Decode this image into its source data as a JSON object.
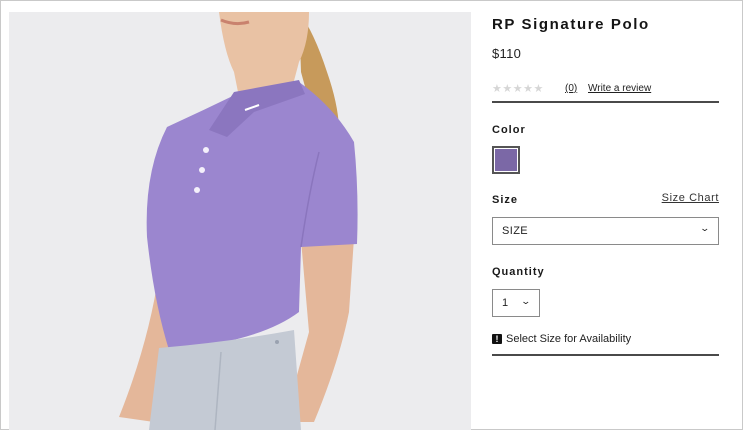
{
  "product": {
    "title": "RP Signature Polo",
    "price": "$110",
    "rating": {
      "stars": "★★★★★",
      "review_count": "(0)",
      "write_review": "Write a review"
    }
  },
  "color": {
    "label": "Color",
    "selected_swatch": "#7b68a6"
  },
  "size": {
    "label": "Size",
    "chart_link": "Size Chart",
    "selected": "SIZE",
    "chevron": "⌄"
  },
  "quantity": {
    "label": "Quantity",
    "selected": "1",
    "chevron": "⌄"
  },
  "availability": {
    "icon": "!",
    "text": "Select Size for Availability"
  },
  "colors": {
    "shirt": "#9b86cf",
    "skirt": "#c4cad4",
    "background": "#ececee"
  },
  "icons": {
    "rating": "star-icon",
    "dropdown": "chevron-down-icon",
    "alert": "exclamation-icon"
  }
}
